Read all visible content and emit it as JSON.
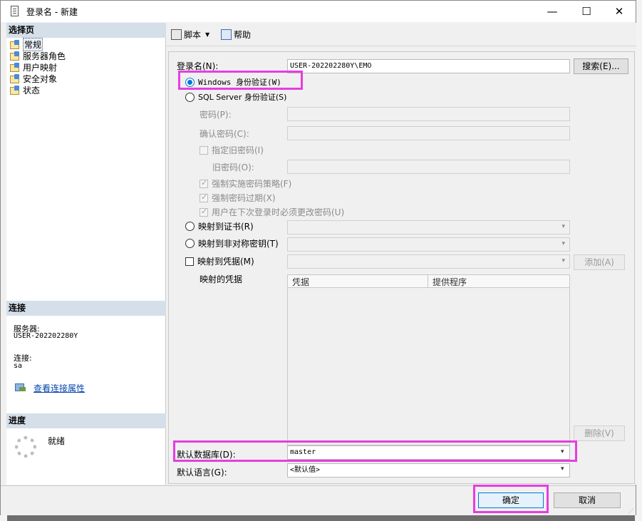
{
  "window": {
    "title": "登录名 - 新建",
    "minimize": "—",
    "maximize": "☐",
    "close": "✕"
  },
  "left": {
    "select_page_header": "选择页",
    "pages": [
      {
        "label": "常规",
        "selected": true
      },
      {
        "label": "服务器角色"
      },
      {
        "label": "用户映射"
      },
      {
        "label": "安全对象"
      },
      {
        "label": "状态"
      }
    ],
    "connection_header": "连接",
    "server_label": "服务器:",
    "server_value": "USER-202202280Y",
    "connection_label": "连接:",
    "connection_value": "sa",
    "view_props_link": "查看连接属性",
    "progress_header": "进度",
    "progress_status": "就绪"
  },
  "toolbar": {
    "script_label": "脚本",
    "help_label": "帮助"
  },
  "general": {
    "login_name_label": "登录名(N):",
    "login_name_value": "USER-202202280Y\\EMO",
    "search_button": "搜索(E)...",
    "windows_auth": "Windows 身份验证(W)",
    "sql_auth": "SQL Server 身份验证(S)",
    "password_label": "密码(P):",
    "confirm_password_label": "确认密码(C):",
    "specify_old_password": "指定旧密码(I)",
    "old_password_label": "旧密码(O):",
    "enforce_policy": "强制实施密码策略(F)",
    "enforce_expiration": "强制密码过期(X)",
    "must_change": "用户在下次登录时必须更改密码(U)",
    "map_certificate": "映射到证书(R)",
    "map_asym_key": "映射到非对称密钥(T)",
    "map_credential": "映射到凭据(M)",
    "add_button": "添加(A)",
    "mapped_credentials_label": "映射的凭据",
    "grid_col_credential": "凭据",
    "grid_col_provider": "提供程序",
    "remove_button": "删除(V)",
    "default_db_label": "默认数据库(D):",
    "default_db_value": "master",
    "default_lang_label": "默认语言(G):",
    "default_lang_value": "<默认值>"
  },
  "footer": {
    "ok_button": "确定",
    "cancel_button": "取消"
  },
  "colors": {
    "highlight": "#e53ee0",
    "section_header": "#d4dfe9",
    "accent": "#0078d7"
  }
}
